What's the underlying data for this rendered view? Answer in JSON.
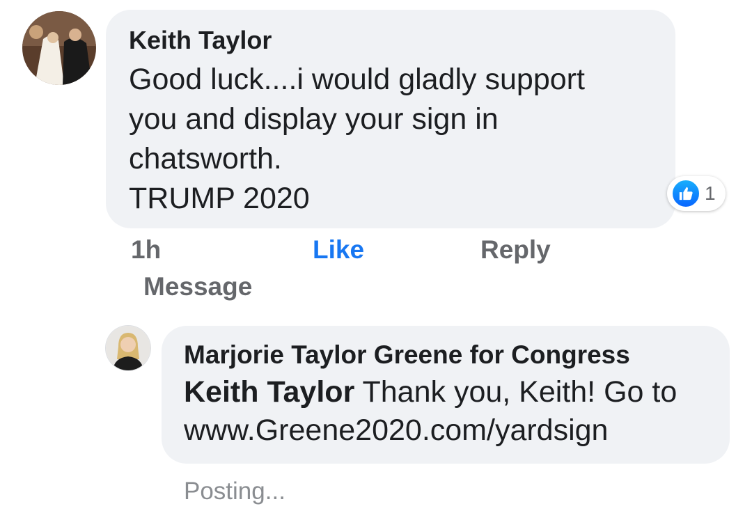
{
  "comment": {
    "author": "Keith Taylor",
    "text": "Good luck....i would gladly support\nyou and display your sign in\nchatsworth.\nTRUMP 2020",
    "reaction": {
      "icon": "like-icon",
      "count": "1",
      "color": "#1877f2"
    },
    "time": "1h",
    "actions": {
      "like": "Like",
      "reply": "Reply",
      "message": "Message"
    },
    "avatar_icon": "wedding-photo-avatar"
  },
  "reply": {
    "author": "Marjorie Taylor Greene for Congress",
    "mention": "Keith Taylor",
    "text": " Thank you, Keith! Go to\nwww.Greene2020.com/yardsign",
    "status": "Posting...",
    "avatar_icon": "profile-photo-avatar"
  },
  "colors": {
    "bubble": "#f0f2f5",
    "accent": "#1877f2",
    "secondary_text": "#65676b"
  }
}
